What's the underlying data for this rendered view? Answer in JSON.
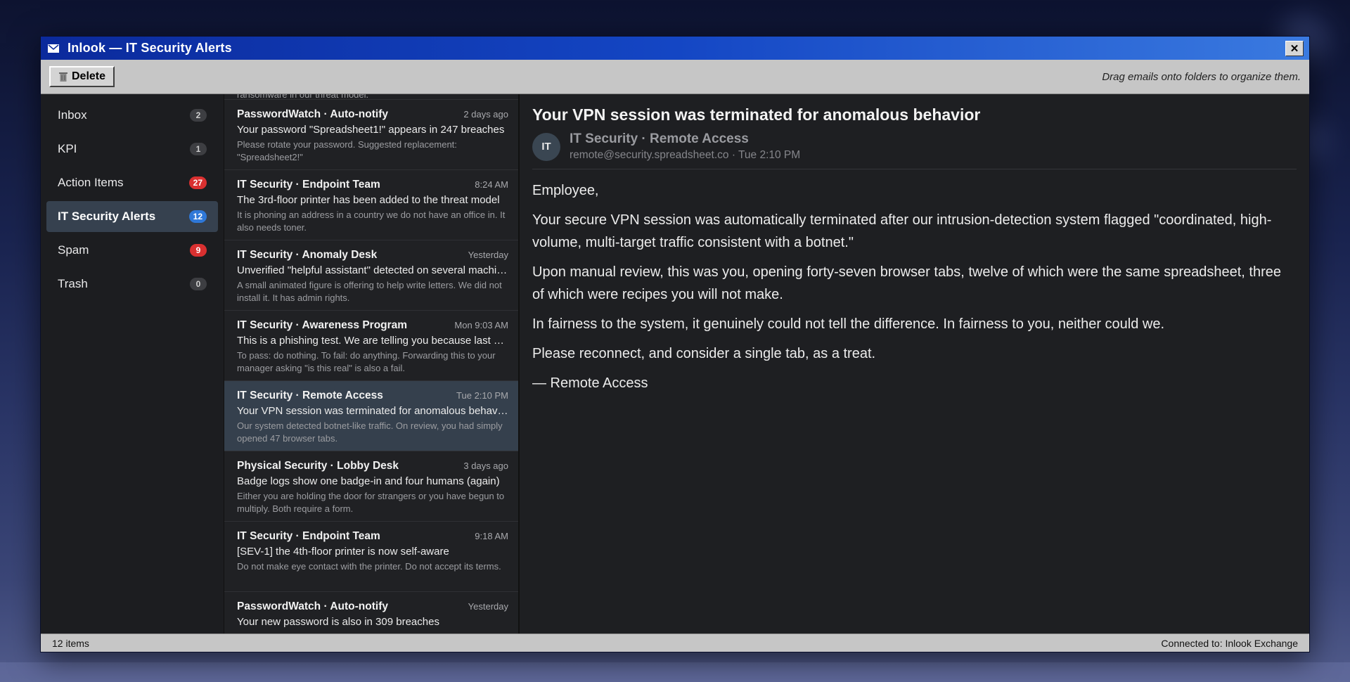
{
  "window": {
    "title": "Inlook — IT Security Alerts"
  },
  "toolbar": {
    "delete_label": "Delete",
    "hint": "Drag emails onto folders to organize them."
  },
  "folders": [
    {
      "name": "Inbox",
      "count": "2",
      "color": "gray"
    },
    {
      "name": "KPI",
      "count": "1",
      "color": "gray"
    },
    {
      "name": "Action Items",
      "count": "27",
      "color": "red"
    },
    {
      "name": "IT Security Alerts",
      "count": "12",
      "color": "blue"
    },
    {
      "name": "Spam",
      "count": "9",
      "color": "red"
    },
    {
      "name": "Trash",
      "count": "0",
      "color": "gray"
    }
  ],
  "messages": [
    {
      "from": "",
      "time": "",
      "subject": "",
      "preview": "ransomware in our threat model."
    },
    {
      "from": "PasswordWatch · Auto-notify",
      "time": "2 days ago",
      "subject": "Your password \"Spreadsheet1!\" appears in 247 breaches",
      "preview": "Please rotate your password. Suggested replacement: \"Spreadsheet2!\""
    },
    {
      "from": "IT Security · Endpoint Team",
      "time": "8:24 AM",
      "subject": "The 3rd-floor printer has been added to the threat model",
      "preview": "It is phoning an address in a country we do not have an office in. It also needs toner."
    },
    {
      "from": "IT Security · Anomaly Desk",
      "time": "Yesterday",
      "subject": "Unverified \"helpful assistant\" detected on several machines",
      "preview": "A small animated figure is offering to help write letters. We did not install it. It has admin rights."
    },
    {
      "from": "IT Security · Awareness Program",
      "time": "Mon 9:03 AM",
      "subject": "This is a phishing test. We are telling you because last quarter",
      "preview": "To pass: do nothing. To fail: do anything. Forwarding this to your manager asking \"is this real\" is also a fail."
    },
    {
      "from": "IT Security · Remote Access",
      "time": "Tue 2:10 PM",
      "subject": "Your VPN session was terminated for anomalous behavior",
      "preview": "Our system detected botnet-like traffic. On review, you had simply opened 47 browser tabs."
    },
    {
      "from": "Physical Security · Lobby Desk",
      "time": "3 days ago",
      "subject": "Badge logs show one badge-in and four humans (again)",
      "preview": "Either you are holding the door for strangers or you have begun to multiply. Both require a form."
    },
    {
      "from": "IT Security · Endpoint Team",
      "time": "9:18 AM",
      "subject": "[SEV-1] the 4th-floor printer is now self-aware",
      "preview": "Do not make eye contact with the printer. Do not accept its terms."
    },
    {
      "from": "PasswordWatch · Auto-notify",
      "time": "Yesterday",
      "subject": "Your new password is also in 309 breaches",
      "preview": ""
    }
  ],
  "reading": {
    "subject": "Your VPN session was terminated for anomalous behavior",
    "avatar": "IT",
    "sender_name": "IT Security · Remote Access",
    "sender_meta": "remote@security.spreadsheet.co · Tue 2:10 PM",
    "body": [
      "Employee,",
      "Your secure VPN session was automatically terminated after our intrusion-detection system flagged \"coordinated, high-volume, multi-target traffic consistent with a botnet.\"",
      "Upon manual review, this was you, opening forty-seven browser tabs, twelve of which were the same spreadsheet, three of which were recipes you will not make.",
      "In fairness to the system, it genuinely could not tell the difference. In fairness to you, neither could we.",
      "Please reconnect, and consider a single tab, as a treat.",
      "— Remote Access"
    ]
  },
  "status": {
    "items": "12 items",
    "connection": "Connected to: Inlook Exchange"
  }
}
